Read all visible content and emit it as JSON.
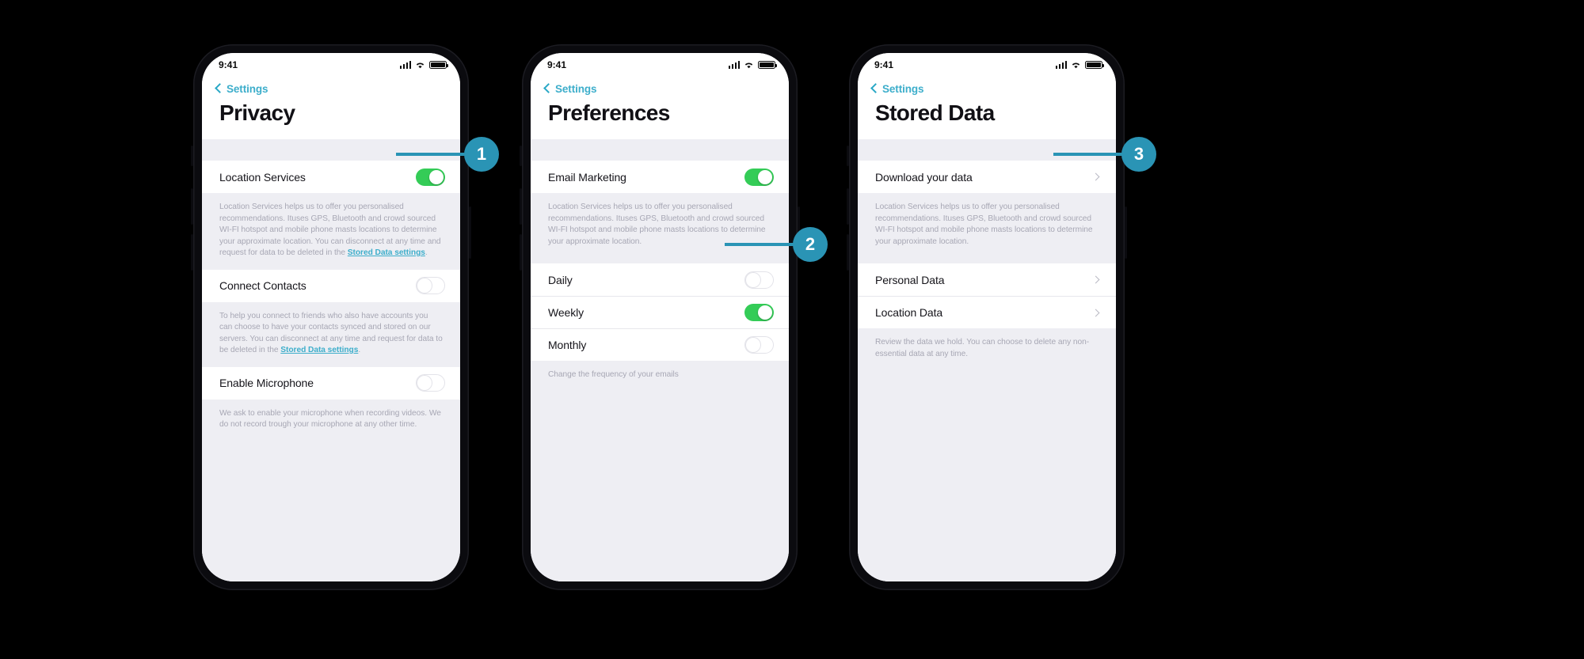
{
  "status_bar": {
    "time": "9:41",
    "signal_icon": "cellular-signal-icon",
    "wifi_icon": "wifi-icon",
    "battery_icon": "battery-icon"
  },
  "common": {
    "back_label": "Settings",
    "location_desc_long": "Location Services helps us to offer you personalised recommendations. Ituses GPS, Bluetooth and crowd sourced WI-FI hotspot and mobile phone masts locations to determine your approximate location. You can disconnect at any time and request for data to be deleted in the ",
    "location_desc_short": "Location Services helps us to offer you personalised recommendations. Ituses GPS, Bluetooth and crowd sourced WI-FI hotspot and mobile phone masts locations to determine your approximate location.",
    "stored_data_link": "Stored Data settings",
    "period": "."
  },
  "screens": [
    {
      "id": "privacy",
      "title": "Privacy",
      "back_label": "Settings",
      "rows": [
        {
          "label": "Location Services",
          "control": "toggle",
          "state": "on"
        },
        {
          "label": "Connect Contacts",
          "control": "toggle",
          "state": "off"
        },
        {
          "label": "Enable Microphone",
          "control": "toggle",
          "state": "off"
        }
      ],
      "descriptions": [
        "Location Services helps us to offer you personalised recommendations. Ituses GPS, Bluetooth and crowd sourced WI-FI hotspot and mobile phone masts locations to determine your approximate location. You can disconnect at any time and request for data to be deleted in the ",
        "To help you connect to friends who also have accounts you can choose to  have your contacts synced and stored on our servers. You can disconnect at any time and request for data to be deleted in the ",
        "We ask to enable your microphone when recording videos. We do not record trough your microphone at any other time."
      ]
    },
    {
      "id": "preferences",
      "title": "Preferences",
      "back_label": "Settings",
      "rows": [
        {
          "label": "Email Marketing",
          "control": "toggle",
          "state": "on"
        },
        {
          "label": "Daily",
          "control": "toggle",
          "state": "off"
        },
        {
          "label": "Weekly",
          "control": "toggle",
          "state": "on"
        },
        {
          "label": "Monthly",
          "control": "toggle",
          "state": "off"
        }
      ],
      "descriptions": [
        "Location Services helps us to offer you personalised recommendations. Ituses GPS, Bluetooth and crowd sourced WI-FI hotspot and mobile phone masts locations to determine your approximate location.",
        "Change the frequency of your emails"
      ]
    },
    {
      "id": "stored-data",
      "title": "Stored Data",
      "back_label": "Settings",
      "rows": [
        {
          "label": "Download your data",
          "control": "chevron"
        },
        {
          "label": "Personal Data",
          "control": "chevron"
        },
        {
          "label": "Location Data",
          "control": "chevron"
        }
      ],
      "descriptions": [
        "Location Services helps us to offer you personalised recommendations. Ituses GPS, Bluetooth and crowd sourced WI-FI hotspot and mobile phone masts locations to determine your approximate location.",
        "Review the data we hold. You can choose to delete any non-essential data at any time."
      ]
    }
  ],
  "callouts": [
    {
      "number": "1"
    },
    {
      "number": "2"
    },
    {
      "number": "3"
    }
  ],
  "colors": {
    "accent_teal": "#2a94b5",
    "link_blue": "#3daecb",
    "toggle_green": "#34cc57",
    "panel_grey": "#eeeef3",
    "text_dark": "#15141a",
    "text_muted": "#a7a7b4"
  }
}
